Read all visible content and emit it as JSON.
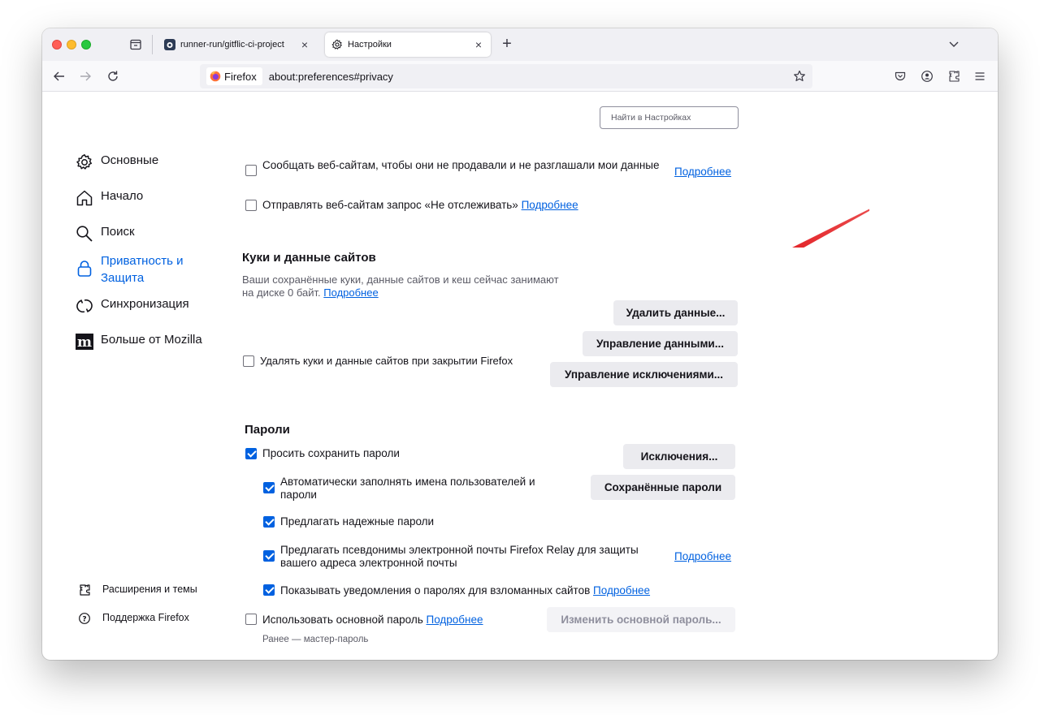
{
  "tabs": [
    {
      "title": "runner-run/gitflic-ci-project",
      "close": "×"
    },
    {
      "title": "Настройки",
      "close": "×"
    }
  ],
  "newtab_label": "+",
  "urlbar": {
    "identity": "Firefox",
    "url": "about:preferences#privacy"
  },
  "search": {
    "placeholder": "Найти в Настройках"
  },
  "sidebar": {
    "items": [
      {
        "label": "Основные"
      },
      {
        "label": "Начало"
      },
      {
        "label": "Поиск"
      },
      {
        "label": "Приватность и Защита"
      },
      {
        "label": "Синхронизация"
      },
      {
        "label": "Больше от Mozilla"
      }
    ],
    "footer": [
      {
        "label": "Расширения и темы"
      },
      {
        "label": "Поддержка Firefox"
      }
    ]
  },
  "privacy": {
    "gpc_label": "Сообщать веб-сайтам, чтобы они не продавали и не разглашали мои данные",
    "gpc_checked": false,
    "dnt_label": "Отправлять веб-сайтам запрос «Не отслеживать»",
    "dnt_checked": false,
    "learn_more": "Подробнее"
  },
  "cookies": {
    "heading": "Куки и данные сайтов",
    "description": "Ваши сохранённые куки, данные сайтов и кеш сейчас занимают на диске 0 байт.",
    "learn_more": "Подробнее",
    "clear_button": "Удалить данные...",
    "manage_button": "Управление данными...",
    "exceptions_button": "Управление исключениями...",
    "delete_on_close_label": "Удалять куки и данные сайтов при закрытии Firefox",
    "delete_on_close_checked": false
  },
  "passwords": {
    "heading": "Пароли",
    "ask_save_label": "Просить сохранить пароли",
    "ask_save_checked": true,
    "exceptions_button": "Исключения...",
    "autofill_label": "Автоматически заполнять имена пользователей и пароли",
    "autofill_checked": true,
    "saved_button": "Сохранённые пароли",
    "suggest_label": "Предлагать надежные пароли",
    "suggest_checked": true,
    "relay_label": "Предлагать псевдонимы электронной почты Firefox Relay для защиты вашего адреса электронной почты",
    "relay_checked": true,
    "relay_learn_more": "Подробнее",
    "breach_label": "Показывать уведомления о паролях для взломанных сайтов",
    "breach_checked": true,
    "breach_learn_more": "Подробнее",
    "primary_label": "Использовать основной пароль",
    "primary_checked": false,
    "primary_learn_more": "Подробнее",
    "primary_button": "Изменить основной пароль...",
    "primary_note": "Ранее — мастер-пароль"
  },
  "colors": {
    "accent": "#0061e0",
    "annotation_arrow": "#e0141b"
  }
}
